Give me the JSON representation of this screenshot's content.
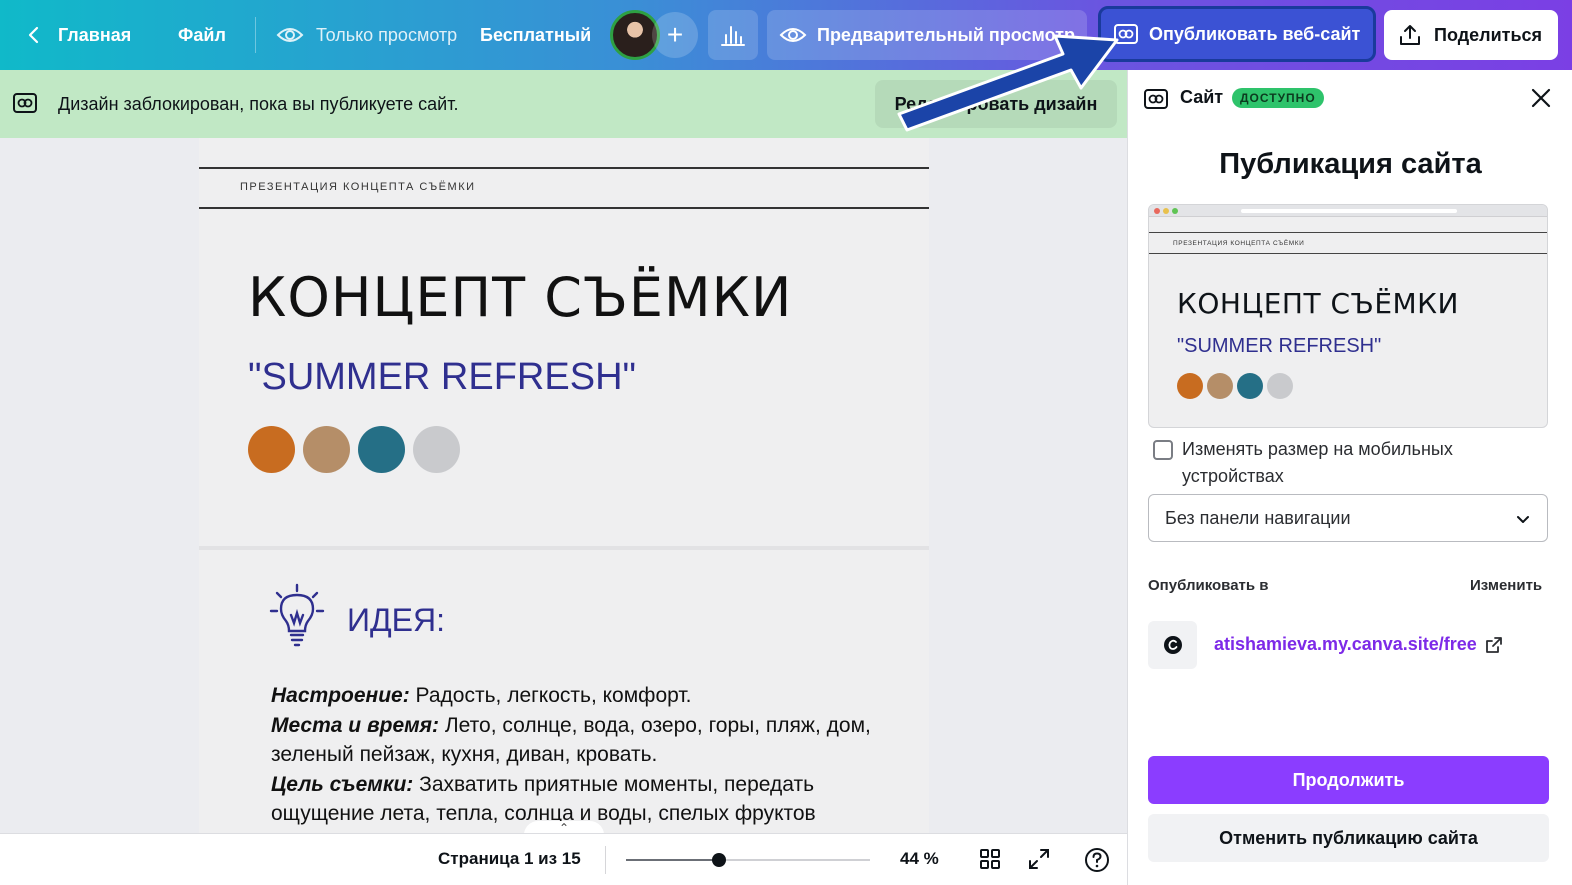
{
  "topbar": {
    "home_label": "Главная",
    "file_label": "Файл",
    "view_only_label": "Только просмотр",
    "plan_label": "Бесплатный",
    "preview_label": "Предварительный просмотр",
    "publish_label": "Опубликовать веб-сайт",
    "share_label": "Поделиться",
    "colors": {
      "gradient_start": "#10b9c9",
      "gradient_end": "#7b3fe4",
      "publish_border": "#1a3a9c"
    }
  },
  "banner": {
    "message": "Дизайн заблокирован, пока вы публикуете сайт.",
    "edit_label": "Редактировать дизайн",
    "color": "#c1e8c5"
  },
  "page": {
    "eyebrow": "ПРЕЗЕНТАЦИЯ КОНЦЕПТА СЪЁМКИ",
    "title": "КОНЦЕПТ СЪЁМКИ",
    "subtitle": "\"SUMMER REFRESH\"",
    "swatches": [
      "#c86c20",
      "#b58e68",
      "#256f86",
      "#c9cacd"
    ],
    "idea_title": "ИДЕЯ:",
    "idea_icon": "lightbulb-icon",
    "mood_label": "Настроение:",
    "mood_text": " Радость, легкость, комфорт.",
    "places_label": "Места и время:",
    "places_text": " Лето, солнце, вода, озеро, горы, пляж, дом, зеленый пейзаж, кухня, диван, кровать.",
    "goal_label": "Цель съемки:",
    "goal_text": " Захватить приятные моменты, передать ощущение лета, тепла, солнца и воды, спелых фруктов"
  },
  "bottombar": {
    "page_count": "Страница 1 из 15",
    "zoom_level": "44 %",
    "zoom_fraction": 0.38
  },
  "panel": {
    "header_label": "Сайт",
    "badge": "ДОСТУПНО",
    "title": "Публикация сайта",
    "preview": {
      "eyebrow": "ПРЕЗЕНТАЦИЯ КОНЦЕПТА СЪЁМКИ",
      "title": "КОНЦЕПТ СЪЁМКИ",
      "subtitle": "\"SUMMER REFRESH\""
    },
    "resize_label": "Изменять размер на мобильных устройствах",
    "resize_checked": false,
    "nav_select_value": "Без панели навигации",
    "publish_to_label": "Опубликовать в",
    "change_label": "Изменить",
    "site_url": "atishamieva.my.canva.site/free",
    "continue_label": "Продолжить",
    "unpublish_label": "Отменить публикацию сайта",
    "accent": "#8b3dff"
  }
}
